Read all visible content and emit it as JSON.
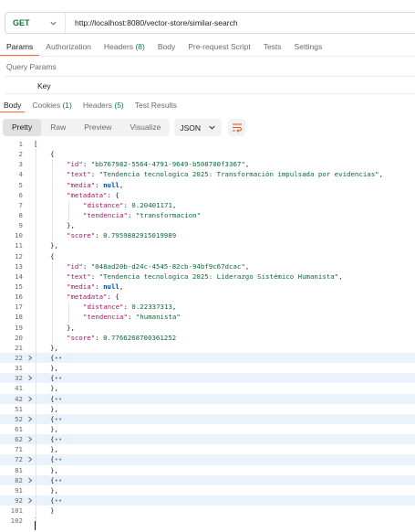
{
  "request": {
    "method": "GET",
    "url": "http://localhost:8080/vector-store/similar-search"
  },
  "request_tabs": [
    {
      "label": "Params",
      "count": "",
      "active": true
    },
    {
      "label": "Authorization",
      "count": "",
      "active": false
    },
    {
      "label": "Headers",
      "count": "(8)",
      "active": false
    },
    {
      "label": "Body",
      "count": "",
      "active": false
    },
    {
      "label": "Pre-request Script",
      "count": "",
      "active": false
    },
    {
      "label": "Tests",
      "count": "",
      "active": false
    },
    {
      "label": "Settings",
      "count": "",
      "active": false
    }
  ],
  "query_params": {
    "title": "Query Params",
    "key_header": "Key"
  },
  "response_tabs": [
    {
      "label": "Body",
      "count": "",
      "active": true
    },
    {
      "label": "Cookies",
      "count": "(1)",
      "active": false
    },
    {
      "label": "Headers",
      "count": "(5)",
      "active": false
    },
    {
      "label": "Test Results",
      "count": "",
      "active": false
    }
  ],
  "view_modes": [
    {
      "label": "Pretty",
      "active": true
    },
    {
      "label": "Raw",
      "active": false
    },
    {
      "label": "Preview",
      "active": false
    },
    {
      "label": "Visualize",
      "active": false
    }
  ],
  "format": {
    "selected": "JSON"
  },
  "colors": {
    "accent": "#ff6c37",
    "method_get": "#0b7a3e",
    "key": "#a3176a",
    "string": "#0b6b3a",
    "keyword": "#0047b3",
    "fold_bg": "#eaf2fb"
  },
  "icons": {
    "method_dropdown": "chevron-down-icon",
    "format_dropdown": "chevron-down-icon",
    "wrap": "wrap-lines-icon",
    "fold": "chevron-right-icon"
  },
  "code_lines": [
    {
      "n": "1",
      "indent": 0,
      "fold": false,
      "parts": [
        [
          "p",
          "["
        ]
      ]
    },
    {
      "n": "2",
      "indent": 1,
      "fold": false,
      "parts": [
        [
          "p",
          "{"
        ]
      ]
    },
    {
      "n": "3",
      "indent": 2,
      "fold": false,
      "parts": [
        [
          "k",
          "\"id\""
        ],
        [
          "p",
          ": "
        ],
        [
          "s",
          "\"bb767982-5564-4791-9649-b508700f3367\""
        ],
        [
          "p",
          ","
        ]
      ]
    },
    {
      "n": "4",
      "indent": 2,
      "fold": false,
      "parts": [
        [
          "k",
          "\"text\""
        ],
        [
          "p",
          ": "
        ],
        [
          "s",
          "\"Tendencia tecnologica 2025: Transformación impulsada por evidencias\""
        ],
        [
          "p",
          ","
        ]
      ]
    },
    {
      "n": "5",
      "indent": 2,
      "fold": false,
      "parts": [
        [
          "k",
          "\"media\""
        ],
        [
          "p",
          ": "
        ],
        [
          "b",
          "null"
        ],
        [
          "p",
          ","
        ]
      ]
    },
    {
      "n": "6",
      "indent": 2,
      "fold": false,
      "parts": [
        [
          "k",
          "\"metadata\""
        ],
        [
          "p",
          ": {"
        ]
      ]
    },
    {
      "n": "7",
      "indent": 3,
      "fold": false,
      "parts": [
        [
          "k",
          "\"distance\""
        ],
        [
          "p",
          ": "
        ],
        [
          "n",
          "0.20401171"
        ],
        [
          "p",
          ","
        ]
      ]
    },
    {
      "n": "8",
      "indent": 3,
      "fold": false,
      "parts": [
        [
          "k",
          "\"tendencia\""
        ],
        [
          "p",
          ": "
        ],
        [
          "s",
          "\"transformacion\""
        ]
      ]
    },
    {
      "n": "9",
      "indent": 2,
      "fold": false,
      "parts": [
        [
          "p",
          "},"
        ]
      ]
    },
    {
      "n": "10",
      "indent": 2,
      "fold": false,
      "parts": [
        [
          "k",
          "\"score\""
        ],
        [
          "p",
          ": "
        ],
        [
          "n",
          "0.7959882915019989"
        ]
      ]
    },
    {
      "n": "11",
      "indent": 1,
      "fold": false,
      "parts": [
        [
          "p",
          "},"
        ]
      ]
    },
    {
      "n": "12",
      "indent": 1,
      "fold": false,
      "parts": [
        [
          "p",
          "{"
        ]
      ]
    },
    {
      "n": "13",
      "indent": 2,
      "fold": false,
      "parts": [
        [
          "k",
          "\"id\""
        ],
        [
          "p",
          ": "
        ],
        [
          "s",
          "\"048ad20b-d24c-4545-82cb-94bf9c67dcac\""
        ],
        [
          "p",
          ","
        ]
      ]
    },
    {
      "n": "14",
      "indent": 2,
      "fold": false,
      "parts": [
        [
          "k",
          "\"text\""
        ],
        [
          "p",
          ": "
        ],
        [
          "s",
          "\"Tendencia tecnologica 2025: Liderazgo Sistémico Humanista\""
        ],
        [
          "p",
          ","
        ]
      ]
    },
    {
      "n": "15",
      "indent": 2,
      "fold": false,
      "parts": [
        [
          "k",
          "\"media\""
        ],
        [
          "p",
          ": "
        ],
        [
          "b",
          "null"
        ],
        [
          "p",
          ","
        ]
      ]
    },
    {
      "n": "16",
      "indent": 2,
      "fold": false,
      "parts": [
        [
          "k",
          "\"metadata\""
        ],
        [
          "p",
          ": {"
        ]
      ]
    },
    {
      "n": "17",
      "indent": 3,
      "fold": false,
      "parts": [
        [
          "k",
          "\"distance\""
        ],
        [
          "p",
          ": "
        ],
        [
          "n",
          "0.22337313"
        ],
        [
          "p",
          ","
        ]
      ]
    },
    {
      "n": "18",
      "indent": 3,
      "fold": false,
      "parts": [
        [
          "k",
          "\"tendencia\""
        ],
        [
          "p",
          ": "
        ],
        [
          "s",
          "\"humanista\""
        ]
      ]
    },
    {
      "n": "19",
      "indent": 2,
      "fold": false,
      "parts": [
        [
          "p",
          "},"
        ]
      ]
    },
    {
      "n": "20",
      "indent": 2,
      "fold": false,
      "parts": [
        [
          "k",
          "\"score\""
        ],
        [
          "p",
          ": "
        ],
        [
          "n",
          "0.7766268700361252"
        ]
      ]
    },
    {
      "n": "21",
      "indent": 1,
      "fold": false,
      "parts": [
        [
          "p",
          "},"
        ]
      ]
    },
    {
      "n": "22",
      "indent": 1,
      "fold": true,
      "parts": [
        [
          "p",
          "{"
        ],
        [
          "d",
          "••"
        ]
      ]
    },
    {
      "n": "31",
      "indent": 1,
      "fold": false,
      "parts": [
        [
          "p",
          "},"
        ]
      ]
    },
    {
      "n": "32",
      "indent": 1,
      "fold": true,
      "parts": [
        [
          "p",
          "{"
        ],
        [
          "d",
          "••"
        ]
      ]
    },
    {
      "n": "41",
      "indent": 1,
      "fold": false,
      "parts": [
        [
          "p",
          "},"
        ]
      ]
    },
    {
      "n": "42",
      "indent": 1,
      "fold": true,
      "parts": [
        [
          "p",
          "{"
        ],
        [
          "d",
          "••"
        ]
      ]
    },
    {
      "n": "51",
      "indent": 1,
      "fold": false,
      "parts": [
        [
          "p",
          "},"
        ]
      ]
    },
    {
      "n": "52",
      "indent": 1,
      "fold": true,
      "parts": [
        [
          "p",
          "{"
        ],
        [
          "d",
          "••"
        ]
      ]
    },
    {
      "n": "61",
      "indent": 1,
      "fold": false,
      "parts": [
        [
          "p",
          "},"
        ]
      ]
    },
    {
      "n": "62",
      "indent": 1,
      "fold": true,
      "parts": [
        [
          "p",
          "{"
        ],
        [
          "d",
          "••"
        ]
      ]
    },
    {
      "n": "71",
      "indent": 1,
      "fold": false,
      "parts": [
        [
          "p",
          "},"
        ]
      ]
    },
    {
      "n": "72",
      "indent": 1,
      "fold": true,
      "parts": [
        [
          "p",
          "{"
        ],
        [
          "d",
          "••"
        ]
      ]
    },
    {
      "n": "81",
      "indent": 1,
      "fold": false,
      "parts": [
        [
          "p",
          "},"
        ]
      ]
    },
    {
      "n": "82",
      "indent": 1,
      "fold": true,
      "parts": [
        [
          "p",
          "{"
        ],
        [
          "d",
          "••"
        ]
      ]
    },
    {
      "n": "91",
      "indent": 1,
      "fold": false,
      "parts": [
        [
          "p",
          "},"
        ]
      ]
    },
    {
      "n": "92",
      "indent": 1,
      "fold": true,
      "parts": [
        [
          "p",
          "{"
        ],
        [
          "d",
          "••"
        ]
      ]
    },
    {
      "n": "101",
      "indent": 1,
      "fold": false,
      "parts": [
        [
          "p",
          "}"
        ]
      ]
    },
    {
      "n": "102",
      "indent": 0,
      "fold": false,
      "parts": [
        [
          "p",
          "]"
        ]
      ]
    }
  ]
}
